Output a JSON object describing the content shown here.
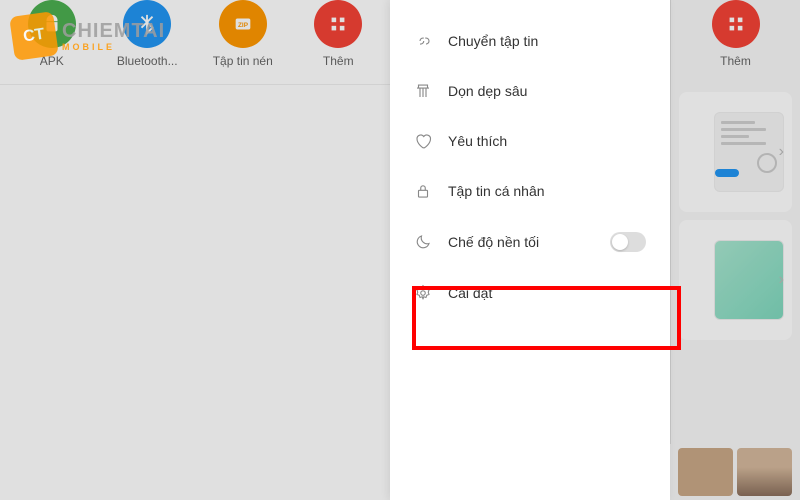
{
  "watermark": {
    "badge": "CT",
    "brand": "CHIEMTAI",
    "sub": "MOBILE"
  },
  "left_grid": [
    {
      "label": "APK",
      "icon": "android"
    },
    {
      "label": "Bluetooth...",
      "icon": "bluetooth"
    },
    {
      "label": "Tập tin nén",
      "icon": "zip"
    },
    {
      "label": "Thêm",
      "icon": "more"
    }
  ],
  "menu": {
    "items": [
      {
        "label": "Chuyển tập tin",
        "icon": "link"
      },
      {
        "label": "Dọn dẹp sâu",
        "icon": "broom"
      },
      {
        "label": "Yêu thích",
        "icon": "heart"
      },
      {
        "label": "Tập tin cá nhân",
        "icon": "lock"
      },
      {
        "label": "Chế độ nền tối",
        "icon": "moon",
        "has_toggle": true,
        "toggle_on": false
      },
      {
        "label": "Cài đặt",
        "icon": "gear",
        "highlighted": true
      }
    ]
  },
  "right_grid": [
    {
      "label": "Thêm",
      "icon": "more"
    }
  ]
}
